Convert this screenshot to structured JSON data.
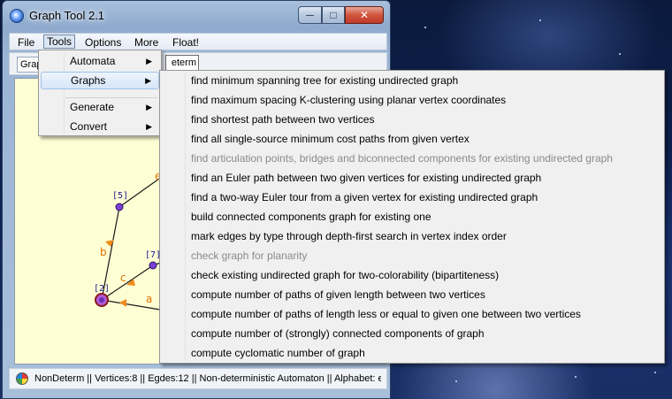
{
  "window": {
    "title": "Graph Tool 2.1",
    "caption_buttons": {
      "minimize": "─",
      "maximize": "□",
      "close": "✕"
    }
  },
  "menubar": {
    "file": "File",
    "tools": "Tools",
    "options": "Options",
    "more": "More",
    "float": "Float!"
  },
  "toolbar": {
    "tab_graph": "Graph",
    "tab_nondeterm": "eterm"
  },
  "tools_menu": {
    "items": [
      {
        "label": "Automata",
        "submenu": true
      },
      {
        "label": "Graphs",
        "submenu": true,
        "highlighted": true
      },
      {
        "label": "Generate",
        "submenu": true
      },
      {
        "label": "Convert",
        "submenu": true
      }
    ]
  },
  "graphs_menu": {
    "items": [
      {
        "label": "find minimum spanning tree for existing undirected graph",
        "enabled": true
      },
      {
        "label": "find maximum spacing K-clustering using planar vertex coordinates",
        "enabled": true
      },
      {
        "label": "find shortest path between two vertices",
        "enabled": true
      },
      {
        "label": "find all single-source minimum cost paths from given vertex",
        "enabled": true
      },
      {
        "label": "find articulation points, bridges and biconnected components for existing undirected graph",
        "enabled": false
      },
      {
        "label": "find an Euler path between two given vertices for existing undirected graph",
        "enabled": true
      },
      {
        "label": "find a two-way Euler tour from a given vertex for existing undirected graph",
        "enabled": true
      },
      {
        "label": "build connected components graph for existing one",
        "enabled": true
      },
      {
        "label": "mark edges by type through depth-first search in vertex index order",
        "enabled": true
      },
      {
        "label": "check graph for planarity",
        "enabled": false
      },
      {
        "label": "check existing undirected graph for two-colorability (bipartiteness)",
        "enabled": true
      },
      {
        "label": "compute number of paths of given length between two vertices",
        "enabled": true
      },
      {
        "label": "compute number of paths of length less or equal to given one between two vertices",
        "enabled": true
      },
      {
        "label": "compute number of (strongly) connected components of graph",
        "enabled": true
      },
      {
        "label": "compute cyclomatic number of graph",
        "enabled": true
      }
    ]
  },
  "graph_canvas": {
    "vertices": [
      {
        "id": "[5]"
      },
      {
        "id": "[7]"
      },
      {
        "id": "[2]"
      }
    ],
    "edge_labels": [
      "e",
      "b",
      "c",
      "a"
    ],
    "colors": {
      "vertex_fill": "#7a3fd1",
      "edge": "#1a1a1a",
      "arrow": "#f08a1a",
      "label": "#e07000",
      "vertex_label": "#1a1a8c",
      "canvas_bg": "#fefed5"
    }
  },
  "statusbar": {
    "icon": "app-status-icon",
    "text": "NonDeterm || Vertices:8 || Egdes:12 || Non-deterministic Automaton || Alphabet: e a"
  }
}
